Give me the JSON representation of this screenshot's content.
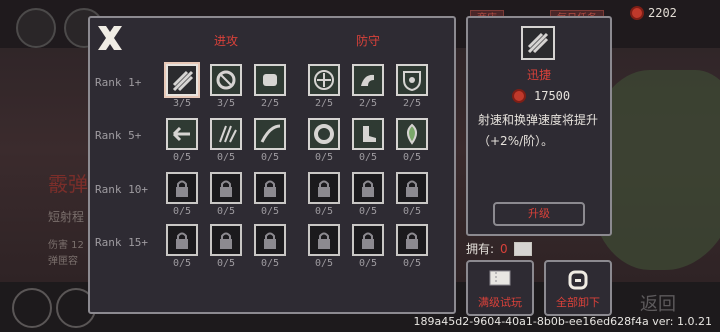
{
  "currency": {
    "amount": "2202",
    "icon": "red-gem-icon",
    "tags": [
      "商店",
      "每日任务"
    ]
  },
  "background": {
    "title": "霰弹",
    "lines": [
      "短射程",
      "伤害 12",
      "弹匣容"
    ],
    "return_label": "返回"
  },
  "skills": {
    "close_icon": "close-x-icon",
    "categories": [
      "进攻",
      "防守"
    ],
    "ranks": [
      {
        "label": "Rank 1+",
        "slots": [
          {
            "icon": "swift-icon",
            "progress": "3/5",
            "state": "active"
          },
          {
            "icon": "swirl-icon",
            "progress": "3/5",
            "state": "normal"
          },
          {
            "icon": "fist-icon",
            "progress": "2/5",
            "state": "normal"
          },
          {
            "icon": "shield-cross-icon",
            "progress": "2/5",
            "state": "normal"
          },
          {
            "icon": "muscle-icon",
            "progress": "2/5",
            "state": "normal"
          },
          {
            "icon": "eye-shield-icon",
            "progress": "2/5",
            "state": "normal"
          }
        ]
      },
      {
        "label": "Rank 5+",
        "slots": [
          {
            "icon": "arrow-left-icon",
            "progress": "0/5",
            "state": "normal"
          },
          {
            "icon": "claws-icon",
            "progress": "0/5",
            "state": "normal"
          },
          {
            "icon": "slash-icon",
            "progress": "0/5",
            "state": "normal"
          },
          {
            "icon": "ring-icon",
            "progress": "0/5",
            "state": "normal"
          },
          {
            "icon": "boot-icon",
            "progress": "0/5",
            "state": "normal"
          },
          {
            "icon": "leaf-shield-icon",
            "progress": "0/5",
            "state": "normal"
          }
        ]
      },
      {
        "label": "Rank 10+",
        "slots": [
          {
            "icon": "lock-icon",
            "progress": "0/5",
            "state": "locked"
          },
          {
            "icon": "lock-icon",
            "progress": "0/5",
            "state": "locked"
          },
          {
            "icon": "lock-icon",
            "progress": "0/5",
            "state": "locked"
          },
          {
            "icon": "lock-icon",
            "progress": "0/5",
            "state": "locked"
          },
          {
            "icon": "lock-icon",
            "progress": "0/5",
            "state": "locked"
          },
          {
            "icon": "lock-icon",
            "progress": "0/5",
            "state": "locked"
          }
        ]
      },
      {
        "label": "Rank 15+",
        "slots": [
          {
            "icon": "lock-icon",
            "progress": "0/5",
            "state": "locked"
          },
          {
            "icon": "lock-icon",
            "progress": "0/5",
            "state": "locked"
          },
          {
            "icon": "lock-icon",
            "progress": "0/5",
            "state": "locked"
          },
          {
            "icon": "lock-icon",
            "progress": "0/5",
            "state": "locked"
          },
          {
            "icon": "lock-icon",
            "progress": "0/5",
            "state": "locked"
          },
          {
            "icon": "lock-icon",
            "progress": "0/5",
            "state": "locked"
          }
        ]
      }
    ]
  },
  "detail": {
    "name": "迅捷",
    "cost": "17500",
    "description": "射速和换弹速度将提升（+2%/阶）。",
    "upgrade_label": "升级"
  },
  "owned": {
    "label": "拥有:",
    "count": "0"
  },
  "buttons": {
    "trial_label": "满级试玩",
    "unequip_label": "全部卸下"
  },
  "version": "189a45d2-9604-40a1-8b0b-ee16ed628f4a ver: 1.0.21",
  "colors": {
    "accent_red": "#d9413a",
    "panel_bg": "#2e2b33",
    "border": "#8c8a90"
  }
}
